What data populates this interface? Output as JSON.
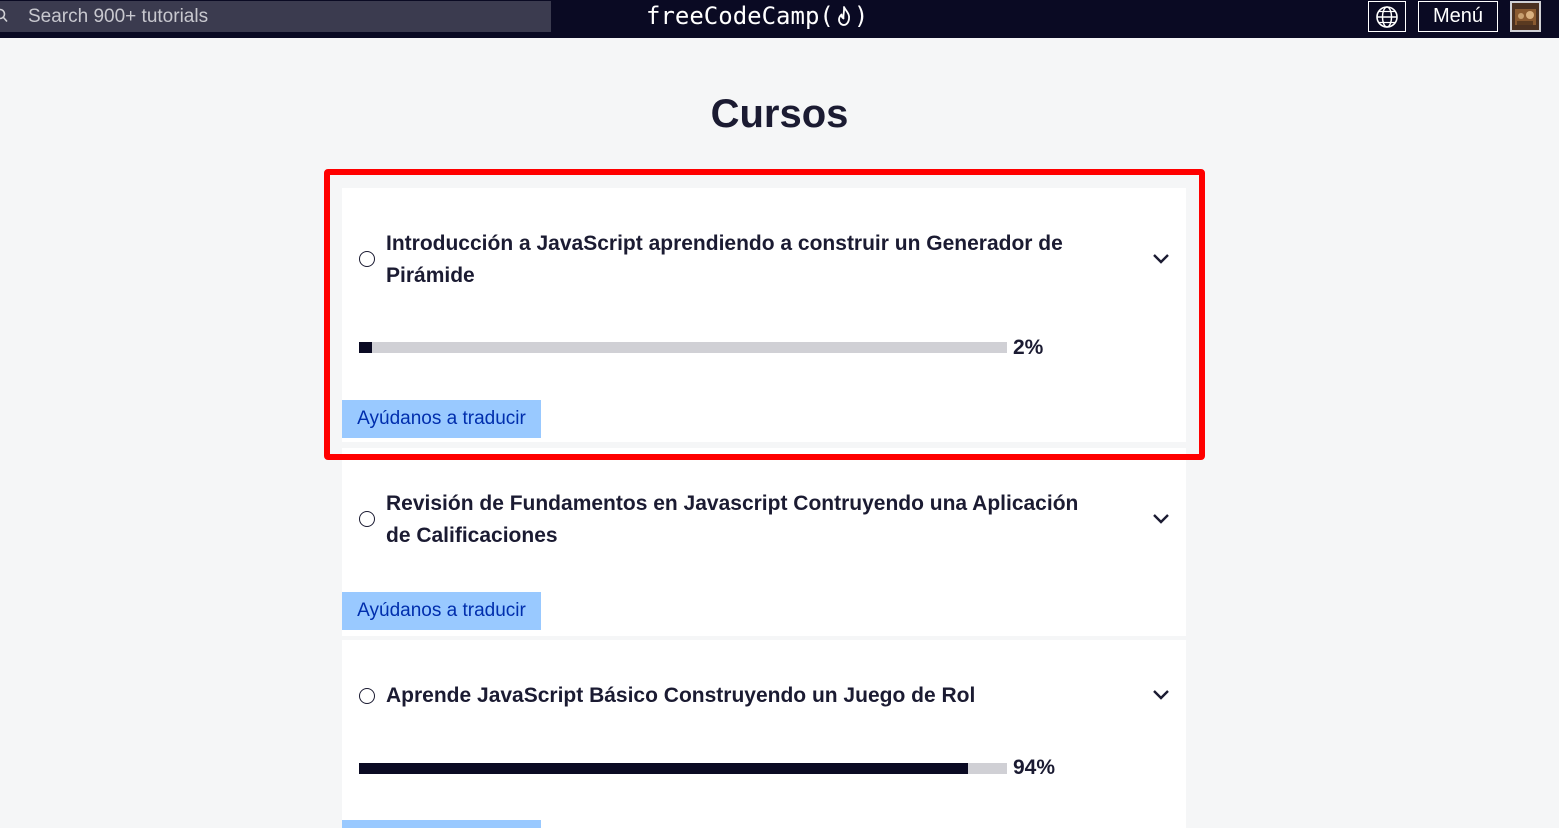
{
  "nav": {
    "search_placeholder": "Search 900+ tutorials",
    "brand_prefix": "freeCodeCamp(",
    "brand_suffix": ")",
    "menu_label": "Menú"
  },
  "page": {
    "title": "Cursos"
  },
  "courses": [
    {
      "title": "Introducción a JavaScript aprendiendo a construir un Generador de Pirámide",
      "progress_percent": 2,
      "progress_label": "2%",
      "translate_label": "Ayúdanos a traducir",
      "highlighted": true
    },
    {
      "title": "Revisión de Fundamentos en Javascript Contruyendo una Aplicación de Calificaciones",
      "translate_label": "Ayúdanos a traducir"
    },
    {
      "title": "Aprende JavaScript Básico Construyendo un Juego de Rol",
      "progress_percent": 94,
      "progress_label": "94%"
    }
  ],
  "colors": {
    "navbar": "#0a0a23",
    "highlight": "#ff0000",
    "translate_bg": "#99c9ff",
    "translate_text": "#002ead",
    "progress_fill": "#0a0a23",
    "progress_track": "#d0d0d5"
  },
  "icons": {
    "search": "search-icon",
    "language": "globe-icon",
    "expand": "chevron-down-icon",
    "status": "radio-circle-icon",
    "brand": "flame-icon"
  }
}
